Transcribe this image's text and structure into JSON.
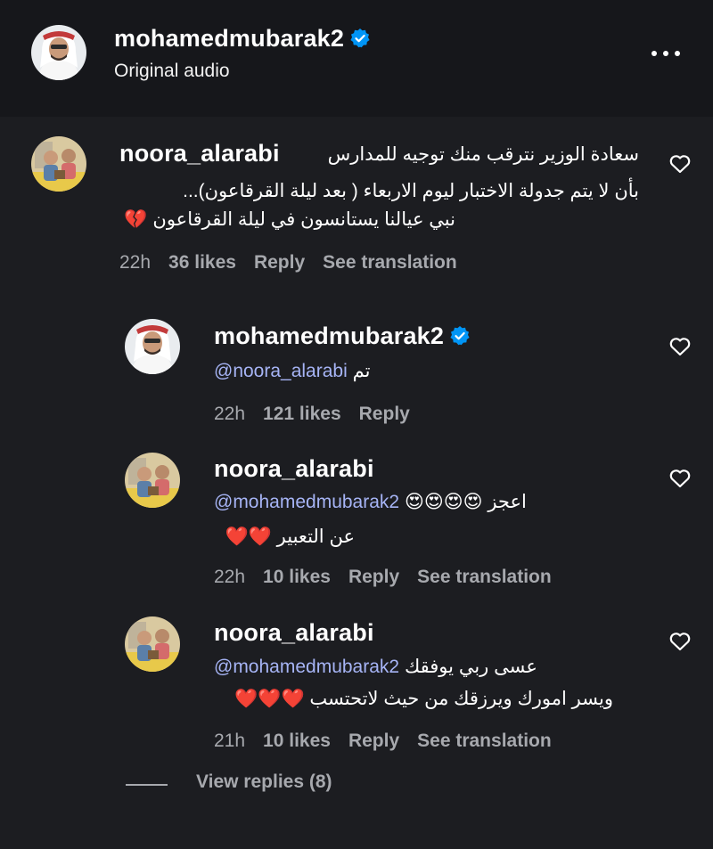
{
  "header": {
    "username": "mohamedmubarak2",
    "subtitle": "Original audio"
  },
  "comment": {
    "username": "noora_alarabi",
    "line1": "سعادة الوزير نترقب منك توجيه للمدارس",
    "line2": "بأن لا يتم جدولة الاختبار ليوم الاربعاء ( بعد ليلة القرقاعون)...",
    "line3": "نبي عيالنا يستانسون في ليلة القرقاعون 💔",
    "time": "22h",
    "likes": "36 likes",
    "reply": "Reply",
    "translate": "See translation"
  },
  "replies": [
    {
      "username": "mohamedmubarak2",
      "mention": "@noora_alarabi",
      "text": "تم",
      "time": "22h",
      "likes": "121 likes",
      "reply": "Reply"
    },
    {
      "username": "noora_alarabi",
      "mention": "@mohamedmubarak2",
      "text": "اعجز 😍😍😍😍",
      "line2": "عن التعبير ❤️❤️",
      "time": "22h",
      "likes": "10 likes",
      "reply": "Reply",
      "translate": "See translation"
    },
    {
      "username": "noora_alarabi",
      "mention": "@mohamedmubarak2",
      "text": "عسى ربي يوفقك",
      "line2": "ويسر امورك ويرزقك من حيث لاتحتسب ❤️❤️❤️",
      "time": "21h",
      "likes": "10 likes",
      "reply": "Reply",
      "translate": "See translation"
    }
  ],
  "view_replies": "View replies (8)",
  "icons": {
    "verified": "verified-badge-icon",
    "more": "more-options-icon",
    "like": "heart-icon"
  },
  "colors": {
    "background": "#1c1d21",
    "mention": "#a6b4f5",
    "verified": "#0095f6",
    "meta": "#a7a9ae"
  }
}
